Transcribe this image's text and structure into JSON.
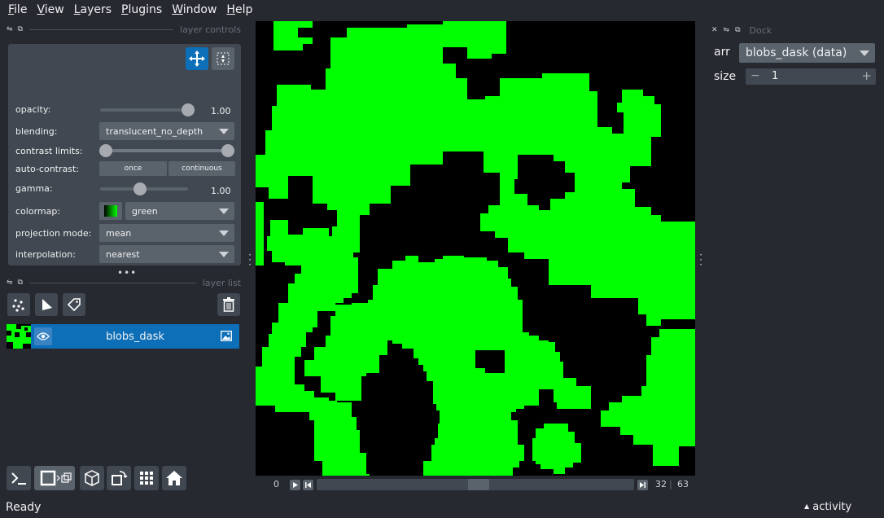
{
  "menu": [
    {
      "label": "File",
      "mnemonic": "F",
      "rest": "ile"
    },
    {
      "label": "View",
      "mnemonic": "V",
      "rest": "iew"
    },
    {
      "label": "Layers",
      "mnemonic": "L",
      "rest": "ayers"
    },
    {
      "label": "Plugins",
      "mnemonic": "P",
      "rest": "lugins"
    },
    {
      "label": "Window",
      "mnemonic": "W",
      "rest": "indow"
    },
    {
      "label": "Help",
      "mnemonic": "H",
      "rest": "elp"
    }
  ],
  "layer_controls": {
    "title": "layer controls",
    "opacity_label": "opacity:",
    "opacity_value": "1.00",
    "opacity_level": 1.0,
    "blending_label": "blending:",
    "blending_value": "translucent_no_depth",
    "contrast_label": "contrast limits:",
    "contrast_range": [
      0.0,
      1.0
    ],
    "auto_contrast_label": "auto-contrast:",
    "auto_once": "once",
    "auto_continuous": "continuous",
    "gamma_label": "gamma:",
    "gamma_value": "1.00",
    "gamma_level": 0.45,
    "colormap_label": "colormap:",
    "colormap_value": "green",
    "projection_label": "projection mode:",
    "projection_value": "mean",
    "interpolation_label": "interpolation:",
    "interpolation_value": "nearest"
  },
  "layer_list": {
    "title": "layer list",
    "layers": [
      {
        "name": "blobs_dask",
        "visible": true,
        "type": "image"
      }
    ]
  },
  "dims": {
    "axis_label": "0",
    "current": "32",
    "max": "63",
    "slider_level": 0.5
  },
  "dock": {
    "title": "Dock",
    "arr_label": "arr",
    "arr_value": "blobs_dask (data)",
    "size_label": "size",
    "size_value": "1",
    "minus": "−",
    "plus": "+"
  },
  "status": {
    "text": "Ready",
    "activity": "activity"
  },
  "colors": {
    "background": "#262930",
    "panel": "#414851",
    "accent": "#0d6fb7",
    "blob": "#00ff00"
  }
}
